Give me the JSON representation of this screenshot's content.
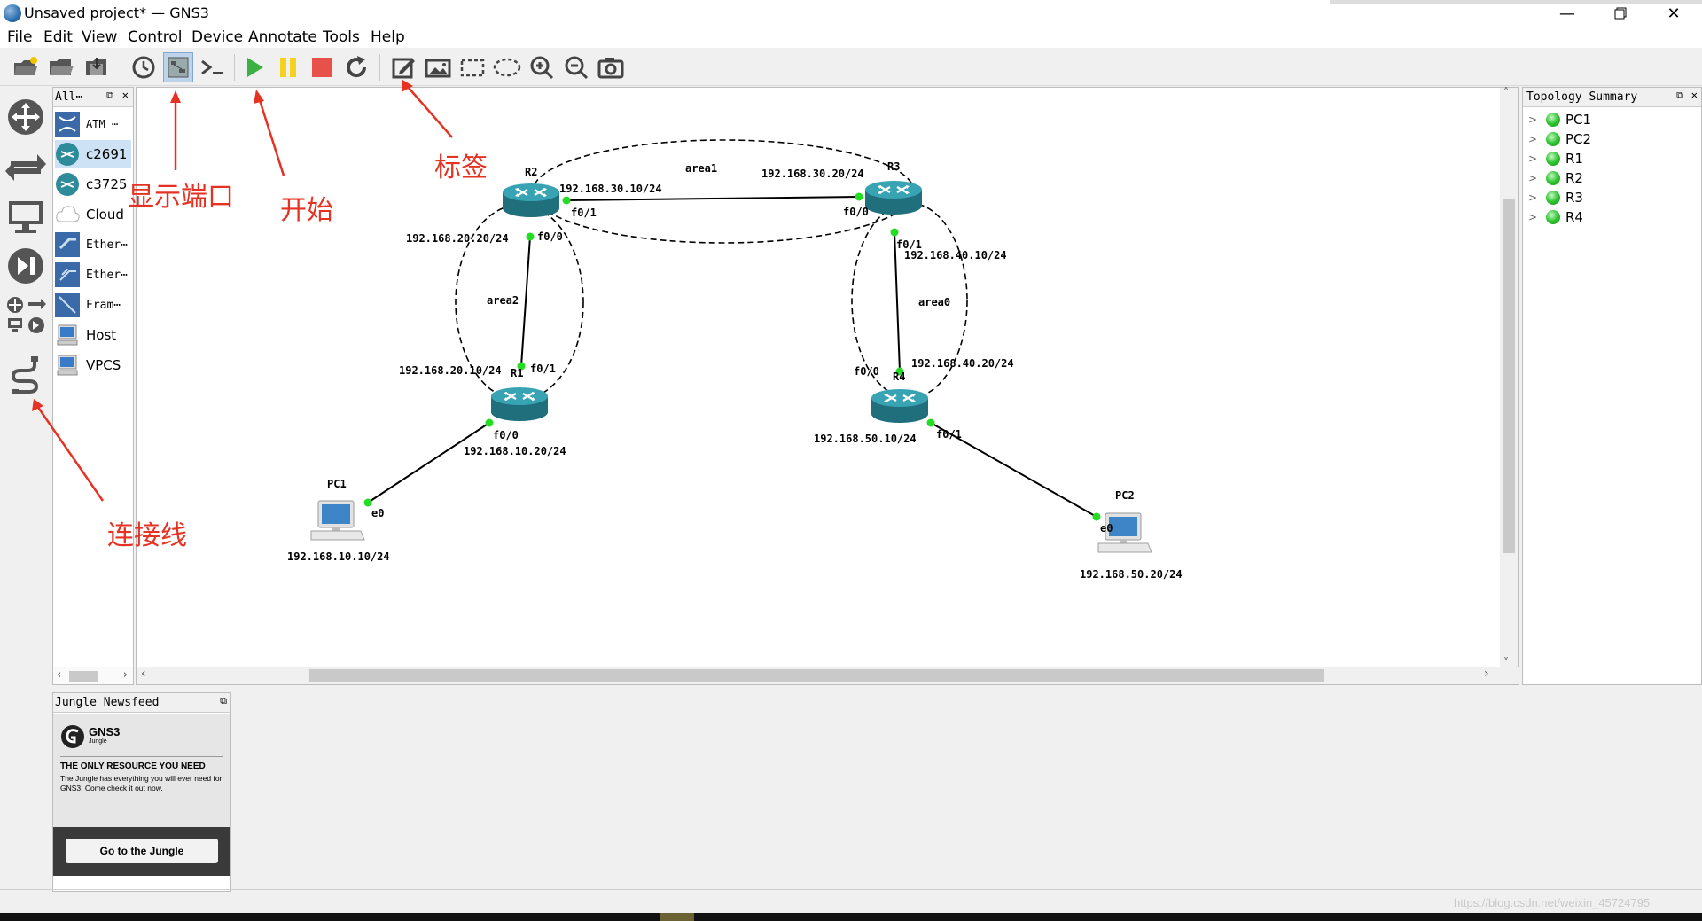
{
  "window": {
    "title": "Unsaved project* — GNS3"
  },
  "menu": [
    "File",
    "Edit",
    "View",
    "Control",
    "Device",
    "Annotate",
    "Tools",
    "Help"
  ],
  "device_panel": {
    "filter_label": "All⋯",
    "devices": [
      {
        "label": "ATM ⋯",
        "icon": "atm-switch-icon"
      },
      {
        "label": "c2691",
        "icon": "router-icon"
      },
      {
        "label": "c3725",
        "icon": "router-icon"
      },
      {
        "label": "Cloud",
        "icon": "cloud-icon"
      },
      {
        "label": "Ether⋯",
        "icon": "ethernet-hub-icon"
      },
      {
        "label": "Ether⋯",
        "icon": "ethernet-switch-icon"
      },
      {
        "label": "Fram⋯",
        "icon": "frame-relay-icon"
      },
      {
        "label": "Host",
        "icon": "host-icon"
      },
      {
        "label": "VPCS",
        "icon": "vpcs-icon"
      }
    ]
  },
  "topology": {
    "nodes": {
      "R2": "R2",
      "R3": "R3",
      "R1": "R1",
      "R4": "R4",
      "PC1": "PC1",
      "PC2": "PC2"
    },
    "areas": {
      "area1": "area1",
      "area2": "area2",
      "area0": "area0"
    },
    "labels": {
      "r2_r3_r2ip": "192.168.30.10/24",
      "r2_r3_r3ip": "192.168.30.20/24",
      "r2_f01": "f0/1",
      "r3_f00": "f0/0",
      "r2_r1_r2ip": "192.168.20.20/24",
      "r2_f00": "f0/0",
      "r1_ip_up": "192.168.20.10/24",
      "r1_f01": "f0/1",
      "r1_f00": "f0/0",
      "r1_pc1_ip": "192.168.10.20/24",
      "pc1_e0": "e0",
      "pc1_ip": "192.168.10.10/24",
      "r3_f01": "f0/1",
      "r3_r4_r3ip": "192.168.40.10/24",
      "r4_ip_up": "192.168.40.20/24",
      "r4_f00": "f0/0",
      "r4_pc2_ip": "192.168.50.10/24",
      "r4_f01": "f0/1",
      "pc2_e0": "e0",
      "pc2_ip": "192.168.50.20/24"
    }
  },
  "annotations": {
    "show_ports": "显示端口",
    "start": "开始",
    "note": "标签",
    "link": "连接线"
  },
  "topology_summary": {
    "title": "Topology Summary",
    "items": [
      "PC1",
      "PC2",
      "R1",
      "R2",
      "R3",
      "R4"
    ],
    "status_color": "#2ec52e"
  },
  "jungle": {
    "title": "Jungle Newsfeed",
    "brand": "GNS3",
    "brand_sub": "Jungle",
    "headline": "THE ONLY RESOURCE YOU NEED",
    "text": "The Jungle has everything you will ever need for GNS3. Come check it out now.",
    "button": "Go to the Jungle"
  },
  "watermark": "https://blog.csdn.net/weixin_45724795",
  "colors": {
    "annotation": "#e53222",
    "router": "#2e8b99",
    "port_up": "#22dd22"
  }
}
